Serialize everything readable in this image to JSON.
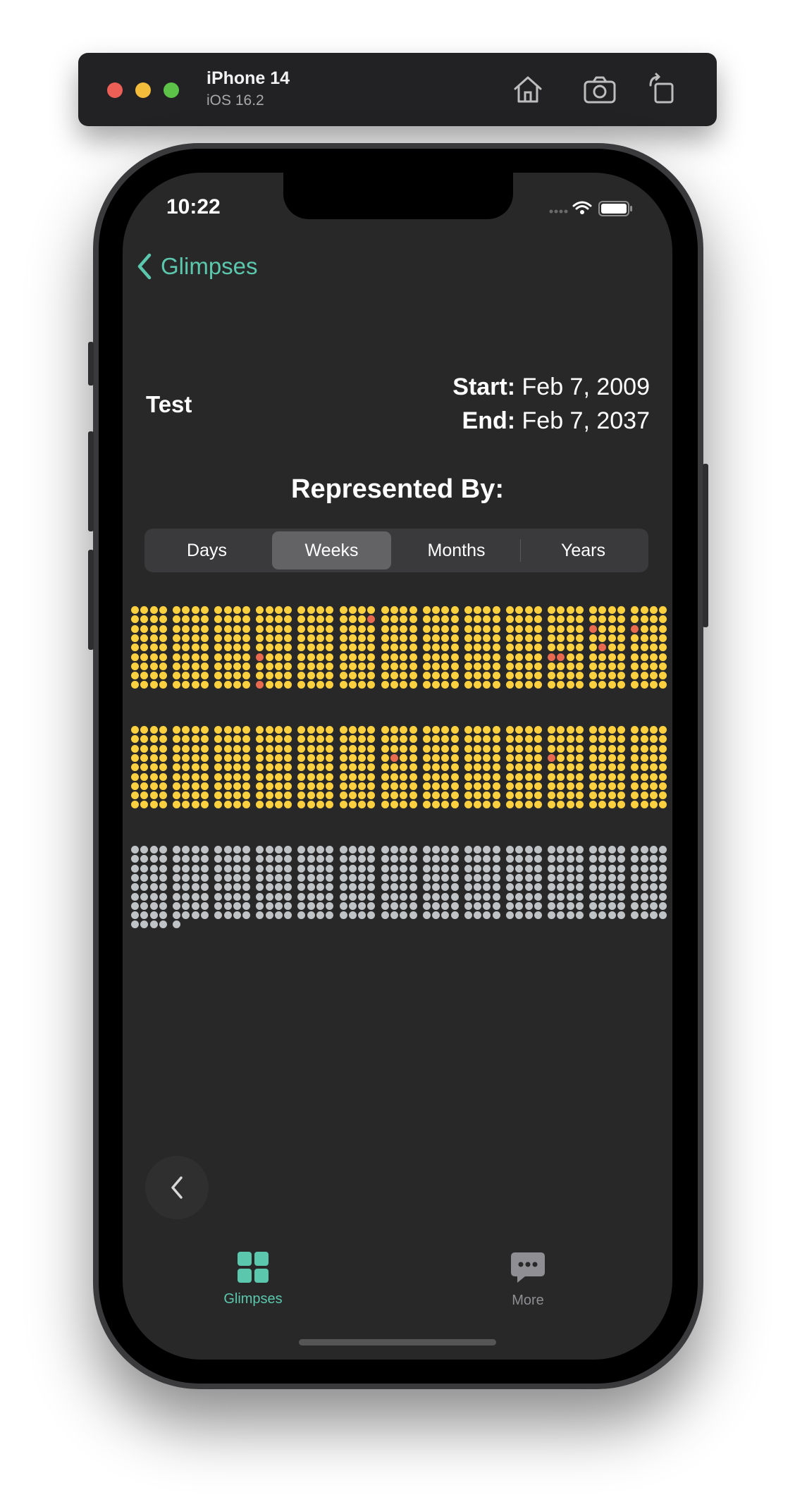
{
  "simulator": {
    "device_name": "iPhone 14",
    "os_version": "iOS 16.2",
    "traffic_light_colors": [
      "#ec5f57",
      "#f4bc3b",
      "#5cc348"
    ],
    "buttons": [
      "home-icon",
      "screenshot-icon",
      "rotate-icon"
    ]
  },
  "status_bar": {
    "time": "10:22"
  },
  "nav": {
    "back_label": "Glimpses"
  },
  "glimpse": {
    "title": "Test",
    "start_label": "Start:",
    "start_date": "Feb 7, 2009",
    "end_label": "End:",
    "end_date": "Feb 7, 2037"
  },
  "represented_by": {
    "heading": "Represented By:",
    "options": [
      "Days",
      "Weeks",
      "Months",
      "Years"
    ],
    "selected": "Weeks"
  },
  "grid_summary": {
    "unit": "weeks",
    "columns_per_row": 13,
    "past_weeks_rows": [
      [
        "all"
      ],
      [
        "partial"
      ],
      [
        "none"
      ]
    ],
    "colors": {
      "past": "#fdd03f",
      "future": "#bfc3c6",
      "marked": "#e86a4f"
    }
  },
  "tab_bar": {
    "items": [
      {
        "label": "Glimpses",
        "icon": "grid-icon",
        "active": true
      },
      {
        "label": "More",
        "icon": "chat-bubble-icon",
        "active": false
      }
    ],
    "accent_color": "#5bc8ae",
    "inactive_color": "#8e8e93"
  }
}
